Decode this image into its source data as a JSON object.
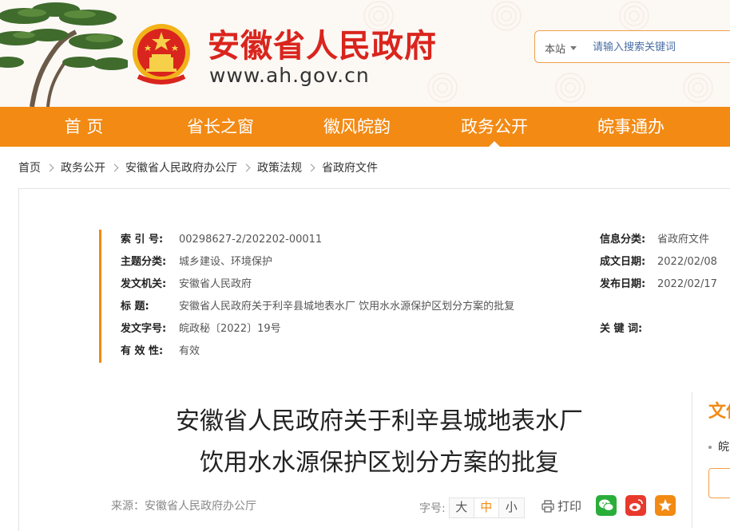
{
  "header": {
    "site_title": "安徽省人民政府",
    "site_url": "www.ah.gov.cn",
    "search": {
      "scope": "本站",
      "placeholder": "请输入搜索关键词"
    }
  },
  "nav": {
    "items": [
      {
        "label": "首 页"
      },
      {
        "label": "省长之窗"
      },
      {
        "label": "徽风皖韵"
      },
      {
        "label": "政务公开"
      },
      {
        "label": "皖事通办"
      }
    ],
    "active": "政务公开"
  },
  "breadcrumb": [
    "首页",
    "政务公开",
    "安徽省人民政府办公厅",
    "政策法规",
    "省政府文件"
  ],
  "meta": {
    "index_label": "索 引 号:",
    "index_value": "00298627-2/202202-00011",
    "category_label": "信息分类:",
    "category_value": "省政府文件",
    "topic_label": "主题分类:",
    "topic_value": "城乡建设、环境保护",
    "date_made_label": "成文日期:",
    "date_made_value": "2022/02/08",
    "issuer_label": "发文机关:",
    "issuer_value": "安徽省人民政府",
    "date_pub_label": "发布日期:",
    "date_pub_value": "2022/02/17",
    "title_label": "标 题:",
    "title_value": "安徽省人民政府关于利辛县城地表水厂 饮用水水源保护区划分方案的批复",
    "docno_label": "发文字号:",
    "docno_value": "皖政秘〔2022〕19号",
    "keywords_label": "关 键 词:",
    "keywords_value": "",
    "validity_label": "有 效 性:",
    "validity_value": "有效"
  },
  "document": {
    "title_line1": "安徽省人民政府关于利辛县城地表水厂",
    "title_line2": "饮用水水源保护区划分方案的批复",
    "source": "来源：安徽省人民政府办公厅",
    "fontsize_label": "字号:",
    "fontsize_options": [
      "大",
      "中",
      "小"
    ],
    "fontsize_selected": "中",
    "print_label": "打印"
  },
  "side": {
    "title": "文件",
    "item": "皖"
  },
  "colors": {
    "brand_red": "#d9251d",
    "nav_orange": "#f28a14",
    "wechat_green": "#2aae3a",
    "weibo_red": "#e8392c"
  }
}
